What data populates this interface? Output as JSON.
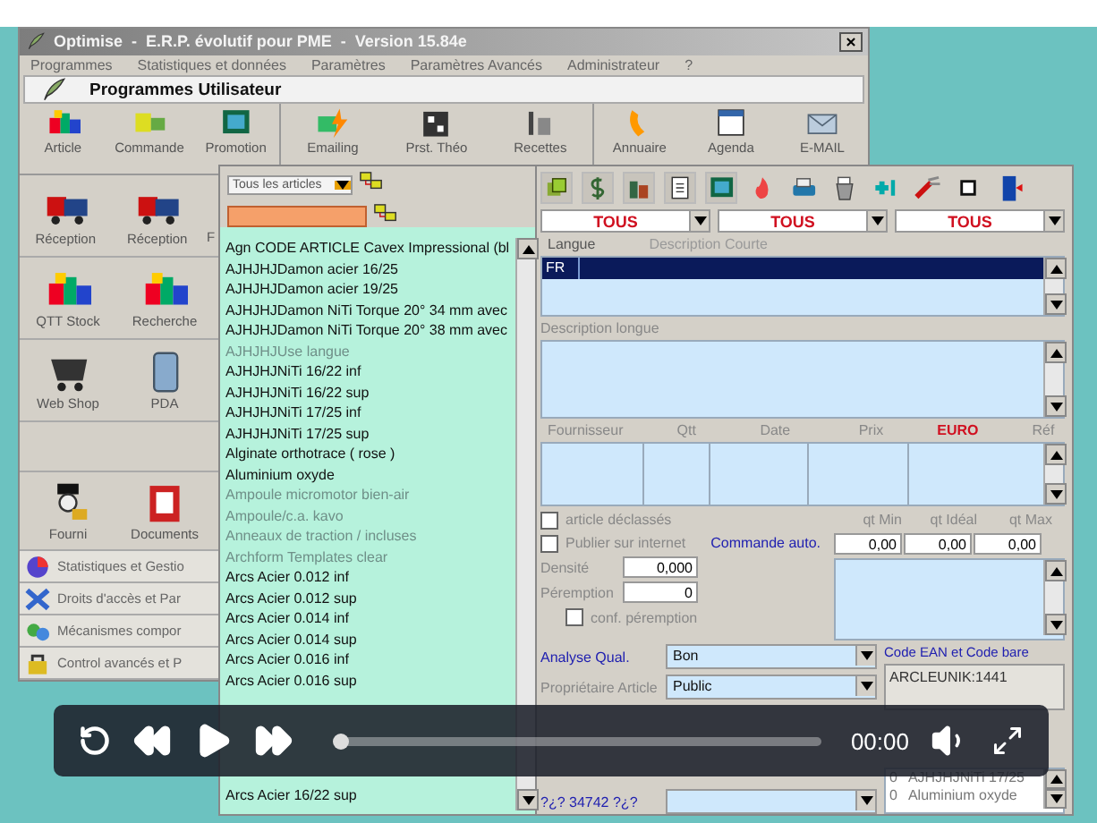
{
  "main_window": {
    "title": "Optimise  -  E.R.P. évolutif pour PME  -  Version 15.84e",
    "menu": [
      "Programmes",
      "Statistiques et données",
      "Paramètres",
      "Paramètres Avancés",
      "Administrateur",
      "?"
    ],
    "section_title": "Programmes Utilisateur",
    "toolbar_groups": [
      {
        "items": [
          "Article",
          "Commande",
          "Promotion"
        ]
      },
      {
        "items": [
          "Emailing",
          "Prst. Théo",
          "Recettes"
        ]
      },
      {
        "items": [
          "Annuaire",
          "Agenda",
          "E-MAIL"
        ]
      }
    ],
    "tile_rows": [
      {
        "tiles": [
          "Réception",
          "Réception",
          "F"
        ]
      },
      {
        "tiles": [
          "QTT Stock",
          "Recherche"
        ]
      },
      {
        "tiles": [
          "Web Shop",
          "PDA"
        ]
      },
      {
        "tiles": []
      },
      {
        "tiles": [
          "Fourni",
          "Documents"
        ]
      }
    ],
    "side_menu": [
      "Statistiques et Gestio",
      "Droits d'accès et Par",
      "Mécanismes compor",
      "Control avancés et P"
    ]
  },
  "article_window": {
    "filter": "Tous les articles",
    "items": [
      {
        "label": "Agn CODE ARTICLE Cavex Impressional (bl",
        "disabled": false
      },
      {
        "label": "AJHJHJDamon acier 16/25",
        "disabled": false
      },
      {
        "label": "AJHJHJDamon acier 19/25",
        "disabled": false
      },
      {
        "label": "AJHJHJDamon NiTi Torque 20° 34 mm avec",
        "disabled": false
      },
      {
        "label": "AJHJHJDamon NiTi Torque 20° 38 mm avec",
        "disabled": false
      },
      {
        "label": "AJHJHJUse langue",
        "disabled": true
      },
      {
        "label": "AJHJHJNiTi 16/22 inf",
        "disabled": false
      },
      {
        "label": "AJHJHJNiTi 16/22 sup",
        "disabled": false
      },
      {
        "label": "AJHJHJNiTi 17/25 inf",
        "disabled": false
      },
      {
        "label": "AJHJHJNiTi 17/25 sup",
        "disabled": false
      },
      {
        "label": "Alginate orthotrace ( rose )",
        "disabled": false
      },
      {
        "label": "Aluminium oxyde",
        "disabled": false
      },
      {
        "label": "Ampoule micromotor bien-air",
        "disabled": true
      },
      {
        "label": "Ampoule/c.a. kavo",
        "disabled": true
      },
      {
        "label": "Anneaux de traction / incluses",
        "disabled": true
      },
      {
        "label": "Archform Templates clear",
        "disabled": true
      },
      {
        "label": "Arcs Acier 0.012 inf",
        "disabled": false
      },
      {
        "label": "Arcs Acier 0.012 sup",
        "disabled": false
      },
      {
        "label": "Arcs Acier 0.014 inf",
        "disabled": false
      },
      {
        "label": "Arcs Acier 0.014 sup",
        "disabled": false
      },
      {
        "label": "Arcs Acier 0.016 inf",
        "disabled": false
      },
      {
        "label": "Arcs Acier 0.016 sup",
        "disabled": false
      }
    ],
    "lower_items": [
      {
        "label": "Arcs Acier 16/22 sup",
        "disabled": false
      }
    ],
    "selects": [
      "TOUS",
      "TOUS",
      "TOUS"
    ],
    "language_grid": {
      "columns": [
        "Langue",
        "Description Courte"
      ],
      "rows": [
        {
          "language": "FR",
          "selected": true
        }
      ]
    },
    "long_description": {
      "label": "Description longue"
    },
    "supplier_grid": {
      "columns": [
        "Fournisseur",
        "Qtt",
        "Date",
        "Prix",
        "Réf"
      ],
      "currency": "EURO"
    },
    "checks": [
      {
        "label": "article déclassés",
        "checked": false
      },
      {
        "label": "Publier sur internet",
        "checked": false
      }
    ],
    "auto_order": {
      "label": "Commande auto.",
      "fields": [
        {
          "label": "qt Min",
          "value": "0,00"
        },
        {
          "label": "qt Idéal",
          "value": "0,00"
        },
        {
          "label": "qt Max",
          "value": "0,00"
        }
      ]
    },
    "density": {
      "label": "Densité",
      "value": "0,000"
    },
    "expiry": {
      "label": "Péremption",
      "value": "0"
    },
    "expiry_confirm": {
      "label": "conf. péremption",
      "checked": false
    },
    "form_rows": [
      {
        "label": "Analyse Qual.",
        "value": "Bon",
        "highlighted": true
      },
      {
        "label": "Propriétaire Article",
        "value": "Public",
        "highlighted": false
      }
    ],
    "lower_form_rows": [
      {
        "label": "?¿? 34742 ?¿?",
        "highlighted": true
      }
    ],
    "barcode": {
      "label": "Code EAN et Code bare",
      "value": "ARCLEUNIK:1441"
    },
    "composition": {
      "rows": [
        {
          "qty": "0",
          "name": "AJHJHJNiTi 17/25",
          "selected": false
        },
        {
          "qty": "0",
          "name": "Aluminium oxyde",
          "selected": false
        }
      ]
    }
  },
  "player": {
    "time": "00:00",
    "level": 0
  }
}
